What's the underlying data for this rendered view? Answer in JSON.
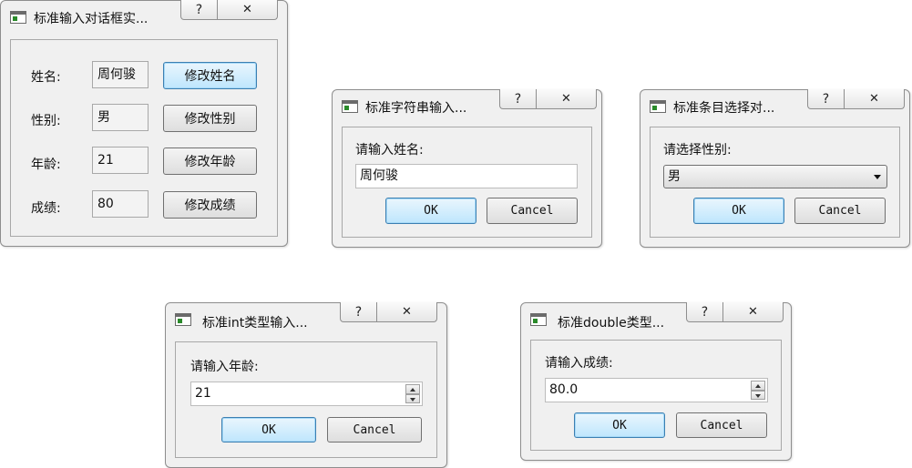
{
  "colors": {
    "dialog_bg": "#f0f0f0",
    "default_button": "#bee6fd",
    "border": "#8e8e8e"
  },
  "icons": {
    "help": "?",
    "close": "✕"
  },
  "main_dialog": {
    "title": "标准输入对话框实...",
    "rows": [
      {
        "label": "姓名:",
        "value": "周何骏",
        "button": "修改姓名"
      },
      {
        "label": "性别:",
        "value": "男",
        "button": "修改性别"
      },
      {
        "label": "年龄:",
        "value": "21",
        "button": "修改年龄"
      },
      {
        "label": "成绩:",
        "value": "80",
        "button": "修改成绩"
      }
    ]
  },
  "string_dialog": {
    "title": "标准字符串输入...",
    "prompt": "请输入姓名:",
    "value": "周何骏",
    "ok": "OK",
    "cancel": "Cancel"
  },
  "item_dialog": {
    "title": "标准条目选择对...",
    "prompt": "请选择性别:",
    "selected": "男",
    "ok": "OK",
    "cancel": "Cancel"
  },
  "int_dialog": {
    "title": "标准int类型输入...",
    "prompt": "请输入年龄:",
    "value": "21",
    "ok": "OK",
    "cancel": "Cancel"
  },
  "double_dialog": {
    "title": "标准double类型...",
    "prompt": "请输入成绩:",
    "value": "80.0",
    "ok": "OK",
    "cancel": "Cancel"
  }
}
